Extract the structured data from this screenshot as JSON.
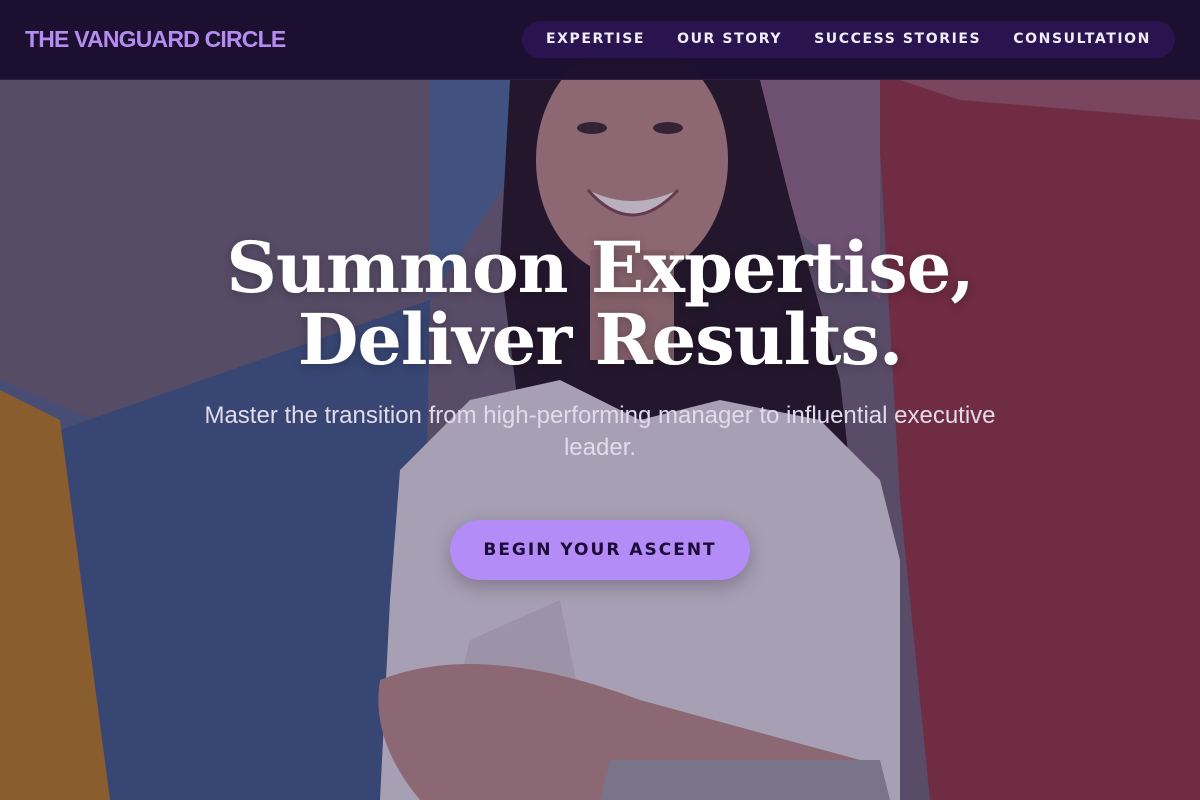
{
  "brand": {
    "name": "THE VANGUARD CIRCLE"
  },
  "nav": {
    "items": [
      {
        "label": "EXPERTISE"
      },
      {
        "label": "OUR STORY"
      },
      {
        "label": "SUCCESS STORIES"
      },
      {
        "label": "CONSULTATION"
      }
    ]
  },
  "hero": {
    "headline_line1": "Summon Expertise,",
    "headline_line2": "Deliver Results.",
    "subheadline": "Master the transition from high-performing manager to influential executive leader.",
    "cta_label": "BEGIN YOUR ASCENT",
    "image_subject": "smiling woman in white shirt against colorful geometric wall"
  },
  "colors": {
    "brand_accent": "#b58cf0",
    "nav_background": "#1a0c2e",
    "nav_pill": "#2a1450",
    "cta_background": "#b48cf7",
    "cta_text": "#1c0b35",
    "headline": "#ffffff"
  }
}
